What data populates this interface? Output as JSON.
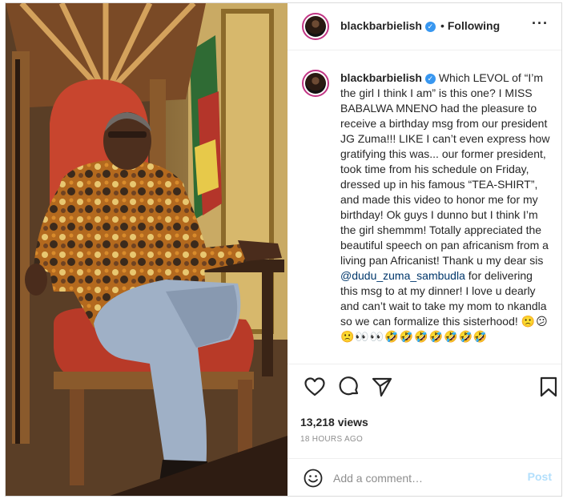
{
  "post": {
    "username": "blackbarbielish",
    "verified_mark": "✓",
    "separator": "•",
    "follow_status": "Following",
    "more_label": "···",
    "caption": {
      "username": "blackbarbielish",
      "text_before_mention": "Which LEVOL of “I’m the girl I think I am” is this one? I MISS BABALWA MNENO had the pleasure to receive a birthday msg from our president JG Zuma!!! LIKE I can’t even express how gratifying this was... our former president, took time from his schedule on Friday, dressed up in his famous “TEA-SHIRT”, and made this video to honor me for my birthday! Ok guys I dunno but I think I’m the girl shemmm! Totally appreciated the beautiful speech on pan africanism from a living pan Africanist! Thank u my dear sis",
      "mention": "@dudu_zuma_sambudla",
      "text_after_mention": "for delivering this msg to at my dinner! I love u dearly and can’t wait to take my mom to nkandla so we can formalize this sisterhood!",
      "emojis": "🙁😕🙁👀👀🤣🤣🤣🤣🤣🤣🤣"
    },
    "views": "13,218 views",
    "timestamp": "18 HOURS AGO",
    "comment_placeholder": "Add a comment…",
    "post_button": "Post"
  },
  "icons": {
    "avatar": "profile-avatar",
    "like": "heart-icon",
    "comment": "comment-icon",
    "share": "paper-plane-icon",
    "save": "bookmark-icon",
    "emoji": "smiley-icon"
  },
  "colors": {
    "verified": "#3897f0",
    "mention": "#00376b",
    "post_button_disabled": "#b2dffc",
    "avatar_ring": "#c13584",
    "muted_text": "#8e8e8e"
  }
}
